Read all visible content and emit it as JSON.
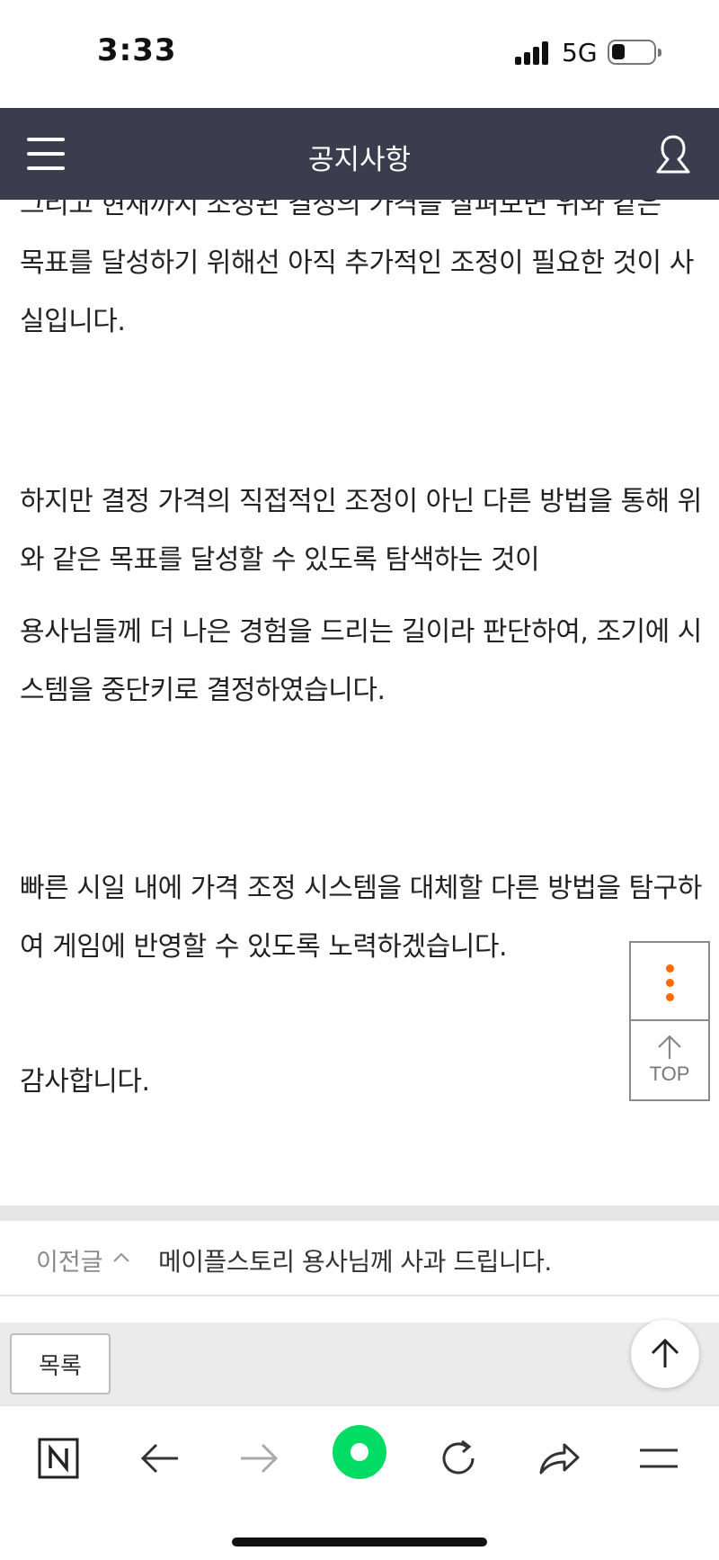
{
  "status_bar": {
    "time": "3:33",
    "network": "5G"
  },
  "header": {
    "title": "공지사항"
  },
  "article": {
    "paragraphs": [
      "그리고 현재까지 조정된 결정의 가격을 살펴보면 위와 같은",
      "목표를 달성하기 위해선 아직 추가적인 조정이 필요한 것이 사실입니다.",
      "하지만 결정 가격의 직접적인 조정이 아닌 다른 방법을 통해 위와 같은 목표를 달성할 수 있도록 탐색하는 것이",
      "용사님들께 더 나은 경험을 드리는 길이라 판단하여, 조기에 시스템을 중단키로 결정하였습니다.",
      "빠른 시일 내에 가격 조정 시스템을 대체할 다른 방법을 탐구하여 게임에 반영할 수 있도록 노력하겠습니다.",
      "감사합니다."
    ]
  },
  "side_tools": {
    "top_label": "TOP"
  },
  "prev_post": {
    "label": "이전글",
    "title": "메이플스토리 용사님께 사과 드립니다."
  },
  "list_button": {
    "label": "목록"
  },
  "colors": {
    "header_bg": "#3b3d4f",
    "accent_orange": "#ff6a00",
    "browser_green": "#00dc64"
  },
  "browser_toolbar": {
    "icons": [
      "naver-n-icon",
      "back-arrow-icon",
      "forward-arrow-icon",
      "green-dot-icon",
      "refresh-icon",
      "share-icon",
      "menu-icon"
    ]
  }
}
